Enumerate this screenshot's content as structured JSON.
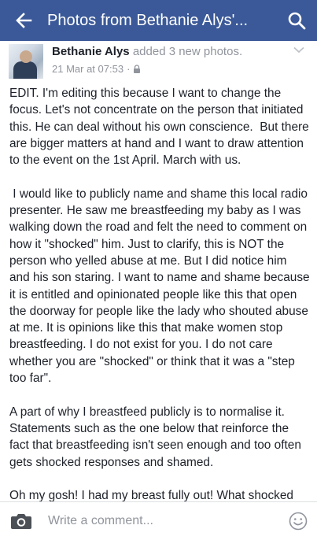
{
  "header": {
    "title": "Photos from Bethanie Alys'...",
    "back_icon": "arrow-left-icon",
    "search_icon": "search-icon",
    "background": "#3b5998"
  },
  "post": {
    "author": "Bethanie Alys",
    "action": "added 3 new photos.",
    "timestamp": "21 Mar at 07:53",
    "separator": "·",
    "privacy_icon": "lock-icon",
    "options_icon": "chevron-down-icon",
    "paragraphs": [
      "EDIT. I'm editing this because I want to change the focus. Let's not concentrate on the person that initiated this. He can deal without his own conscience.  But there are bigger matters at hand and I want to draw attention to the event on the 1st April. March with us.",
      " I would like to publicly name and shame this local radio presenter. He saw me breastfeeding my baby as I was walking down the road and felt the need to comment on how it \"shocked\" him. Just to clarify, this is NOT the person who yelled abuse at me. But I did notice him and his son staring. I want to name and shame because it is entitled and opinionated people like this that open the doorway for people like the lady who shouted abuse at me. It is opinions like this that make women stop breastfeeding. I do not exist for you. I do not care whether you are \"shocked\" or think that it was a \"step too far\".",
      "A part of why I breastfeed publicly is to normalise it. Statements such as the one below that reinforce the fact that breastfeeding isn't seen enough and too often gets shocked responses and shamed.",
      "Oh my gosh! I had my breast fully out! What shocked"
    ]
  },
  "comment_bar": {
    "placeholder": "Write a comment...",
    "camera_icon": "camera-icon",
    "emoji_icon": "smiley-icon"
  }
}
